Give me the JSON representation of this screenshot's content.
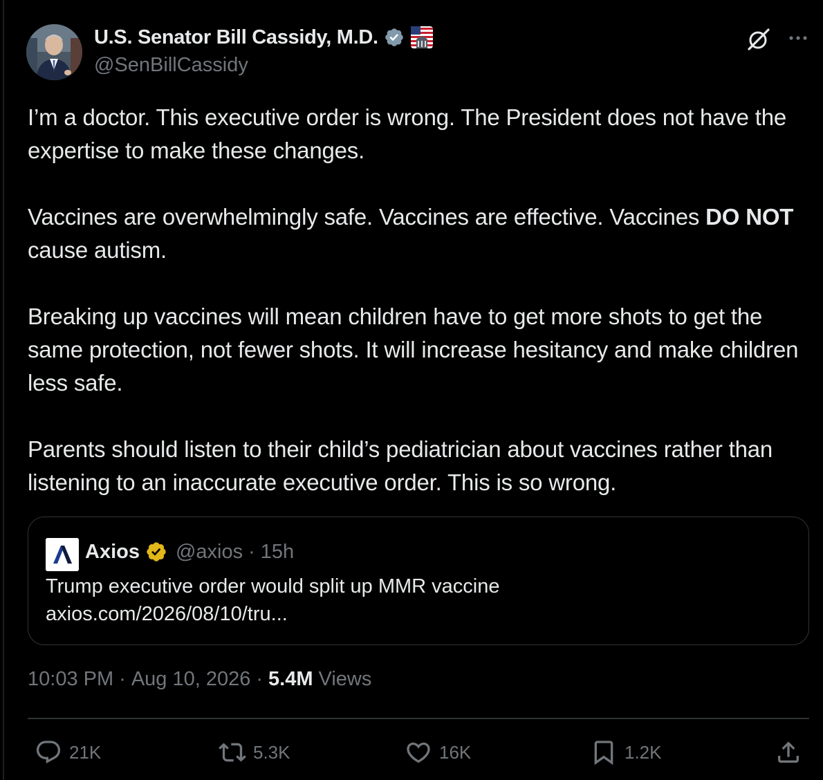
{
  "author": {
    "display_name": "U.S. Senator Bill Cassidy, M.D.",
    "handle": "@SenBillCassidy",
    "verified_color": "#829aab"
  },
  "body": {
    "p1": "I’m a doctor. This executive order is wrong. The President does not have the expertise to make these changes.",
    "p2_a": "Vaccines are overwhelmingly safe. Vaccines are effective. Vaccines ",
    "p2_bold": "DO NOT",
    "p2_b": " cause autism.",
    "p3": "Breaking up vaccines will mean children have to get more shots to get the same protection, not fewer shots. It will increase hesitancy and make children less safe.",
    "p4": "Parents should listen to their child’s pediatrician about vaccines rather than listening to an inaccurate executive order. This is so wrong."
  },
  "quote": {
    "name": "Axios",
    "logo_letter": "Λ",
    "handle": "@axios",
    "separator": "·",
    "time": "15h",
    "text_line1": "Trump executive order would split up MMR vaccine",
    "text_line2": "axios.com/2026/08/10/tru...",
    "badge_color": "#e2b719"
  },
  "meta": {
    "time": "10:03 PM",
    "sep1": "·",
    "date": "Aug 10, 2026",
    "sep2": "·",
    "views_count": "5.4M",
    "views_label": "Views"
  },
  "actions": {
    "replies": "21K",
    "reposts": "5.3K",
    "likes": "16K",
    "bookmarks": "1.2K"
  },
  "colors": {
    "background": "#000000",
    "text": "#e7e9ea",
    "muted": "#71767b",
    "border": "#2f3336"
  }
}
